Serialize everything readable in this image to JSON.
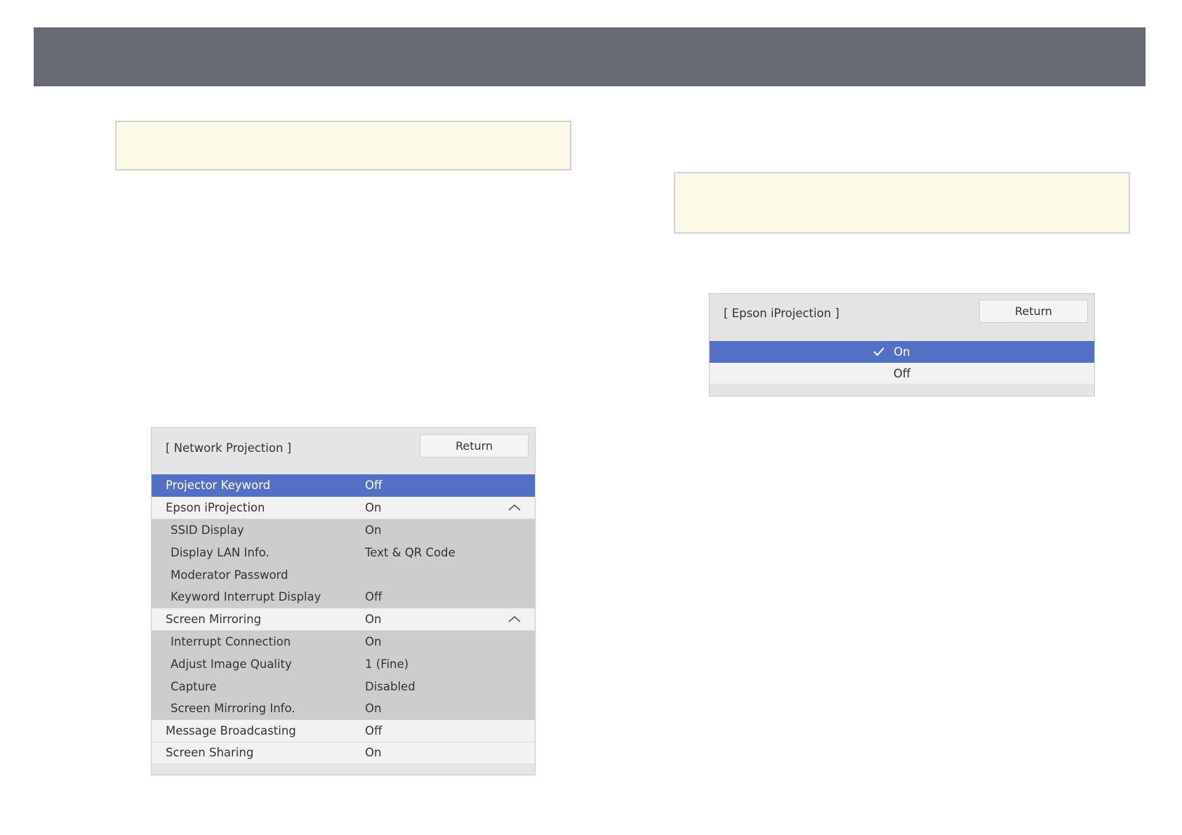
{
  "network_menu": {
    "title": "[ Network Projection ]",
    "return_label": "Return",
    "rows": [
      {
        "label": "Projector Keyword",
        "value": "Off"
      },
      {
        "label": "Epson iProjection",
        "value": "On"
      },
      {
        "label": "SSID Display",
        "value": "On"
      },
      {
        "label": "Display LAN Info.",
        "value": "Text & QR Code"
      },
      {
        "label": "Moderator Password",
        "value": ""
      },
      {
        "label": "Keyword Interrupt Display",
        "value": "Off"
      },
      {
        "label": "Screen Mirroring",
        "value": "On"
      },
      {
        "label": "Interrupt Connection",
        "value": "On"
      },
      {
        "label": "Adjust Image Quality",
        "value": "1 (Fine)"
      },
      {
        "label": "Capture",
        "value": "Disabled"
      },
      {
        "label": "Screen Mirroring Info.",
        "value": "On"
      },
      {
        "label": "Message Broadcasting",
        "value": "Off"
      },
      {
        "label": "Screen Sharing",
        "value": "On"
      }
    ]
  },
  "iprojection_menu": {
    "title": "[ Epson iProjection ]",
    "return_label": "Return",
    "options": [
      "On",
      "Off"
    ]
  },
  "colors": {
    "header_bar": "#666a73",
    "selection": "#5470c6",
    "note_background": "#fdf9e8"
  }
}
